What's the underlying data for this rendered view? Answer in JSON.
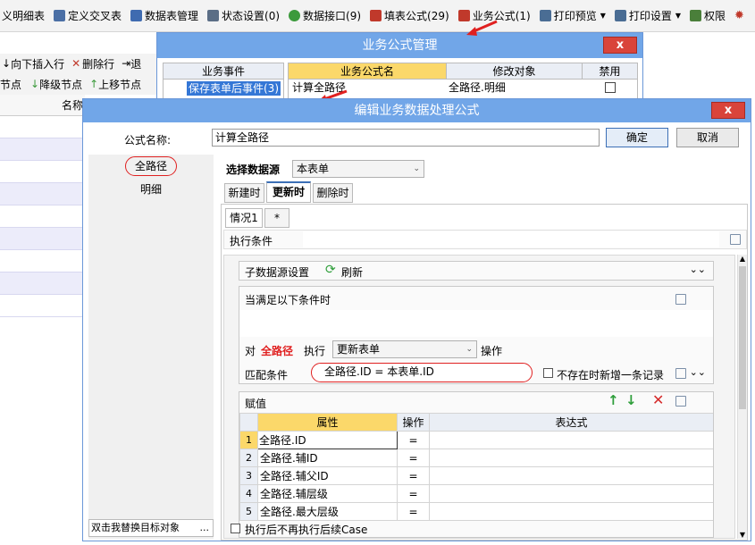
{
  "toolbar": {
    "items": [
      {
        "label": "义明细表",
        "color": "#6a7e9b"
      },
      {
        "label": "定义交叉表",
        "color": "#4b6fa5"
      },
      {
        "label": "数据表管理",
        "color": "#3f6bb0"
      },
      {
        "label": "状态设置(0)",
        "color": "#5b6e86"
      },
      {
        "label": "数据接口(9)",
        "color": "#3c9a3c"
      },
      {
        "label": "填表公式(29)",
        "color": "#c0392b"
      },
      {
        "label": "业务公式(1)",
        "color": "#c0392b"
      },
      {
        "label": "打印预览",
        "color": "#4a6d94"
      },
      {
        "label": "打印设置",
        "color": "#4a6d94"
      },
      {
        "label": "权限",
        "color": "#4a7f3a"
      }
    ]
  },
  "bg": {
    "insert_row": "向下插入行",
    "delete_row": "删除行",
    "back": "退",
    "node": "节点",
    "demote": "降级节点",
    "move_up": "上移节点",
    "name_col": "名称"
  },
  "dlg1": {
    "title": "业务公式管理",
    "close": "x",
    "cols": [
      "业务事件",
      "业务公式名",
      "修改对象",
      "禁用"
    ],
    "event": "保存表单后事件(3)",
    "formula": "计算全路径",
    "target": "全路径.明细"
  },
  "dlg2": {
    "title": "编辑业务数据处理公式",
    "close": "x",
    "formula_label": "公式名称:",
    "formula_name": "计算全路径",
    "ok": "确定",
    "cancel": "取消",
    "left_items": [
      "全路径",
      "明细"
    ],
    "left_bottom": "双击我替换目标对象",
    "left_bottom_more": "...",
    "ds_label": "选择数据源",
    "ds_value": "本表单",
    "tabs": [
      "新建时",
      "更新时",
      "删除时"
    ],
    "case_tabs": [
      "情况1",
      "*"
    ],
    "exec_cond": "执行条件",
    "subds": "子数据源设置",
    "refresh": "刷新",
    "when": "当满足以下条件时",
    "to": "对",
    "target": "全路径",
    "exec": "执行",
    "action": "更新表单",
    "op": "操作",
    "match": "匹配条件",
    "match_expr": "全路径.ID = 本表单.ID",
    "not_exist": "不存在时新增一条记录",
    "assign": "赋值",
    "grid_cols": [
      "属性",
      "操作",
      "表达式"
    ],
    "rows": [
      {
        "n": "1",
        "prop": "全路径.ID",
        "op": "="
      },
      {
        "n": "2",
        "prop": "全路径.辅ID",
        "op": "="
      },
      {
        "n": "3",
        "prop": "全路径.辅父ID",
        "op": "="
      },
      {
        "n": "4",
        "prop": "全路径.辅层级",
        "op": "="
      },
      {
        "n": "5",
        "prop": "全路径.最大层级",
        "op": "="
      }
    ],
    "after_exec": "执行后不再执行后续Case"
  }
}
